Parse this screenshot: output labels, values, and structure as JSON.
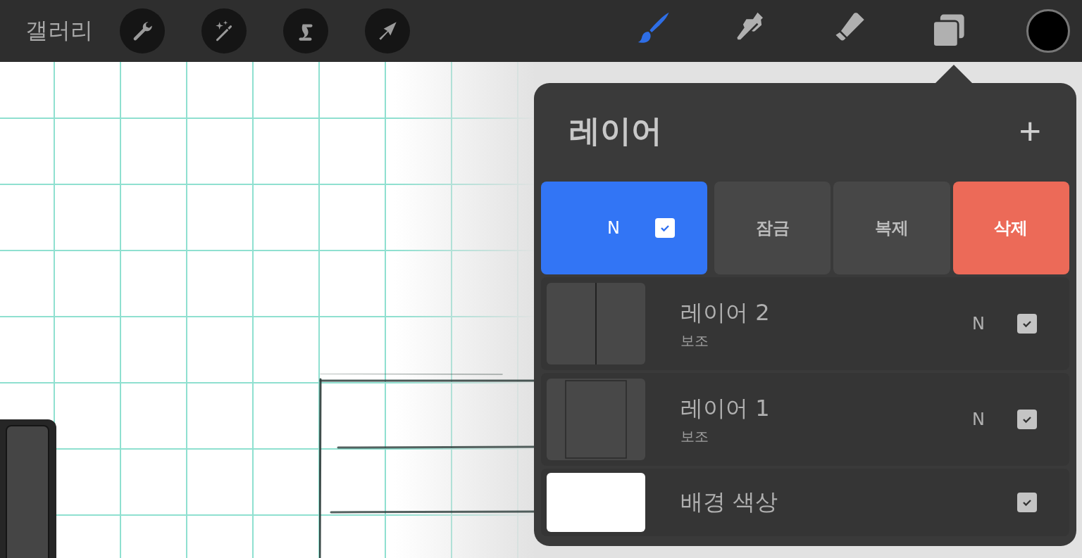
{
  "toolbar": {
    "gallery": "갤러리",
    "left_tools": [
      {
        "kind": "wrench"
      },
      {
        "kind": "wand"
      },
      {
        "kind": "selection"
      },
      {
        "kind": "arrow"
      }
    ],
    "right_tools": [
      {
        "kind": "brush",
        "selected": true
      },
      {
        "kind": "smudge",
        "selected": false
      },
      {
        "kind": "eraser",
        "selected": false
      },
      {
        "kind": "layers",
        "selected": false
      }
    ]
  },
  "layers_panel": {
    "title": "레이어",
    "add": "+",
    "selected_layer": {
      "blend": "N",
      "visible": true
    },
    "actions": [
      {
        "label": "잠금",
        "kind": "plain"
      },
      {
        "label": "복제",
        "kind": "plain"
      },
      {
        "label": "삭제",
        "kind": "danger"
      }
    ],
    "layers": [
      {
        "kind": "layer",
        "name": "레이어 2",
        "sublabel": "보조",
        "blend": "N",
        "visible": true
      },
      {
        "kind": "layer",
        "name": "레이어 1",
        "sublabel": "보조",
        "blend": "N",
        "visible": true
      },
      {
        "kind": "background",
        "name": "배경 색상",
        "visible": true
      }
    ]
  }
}
